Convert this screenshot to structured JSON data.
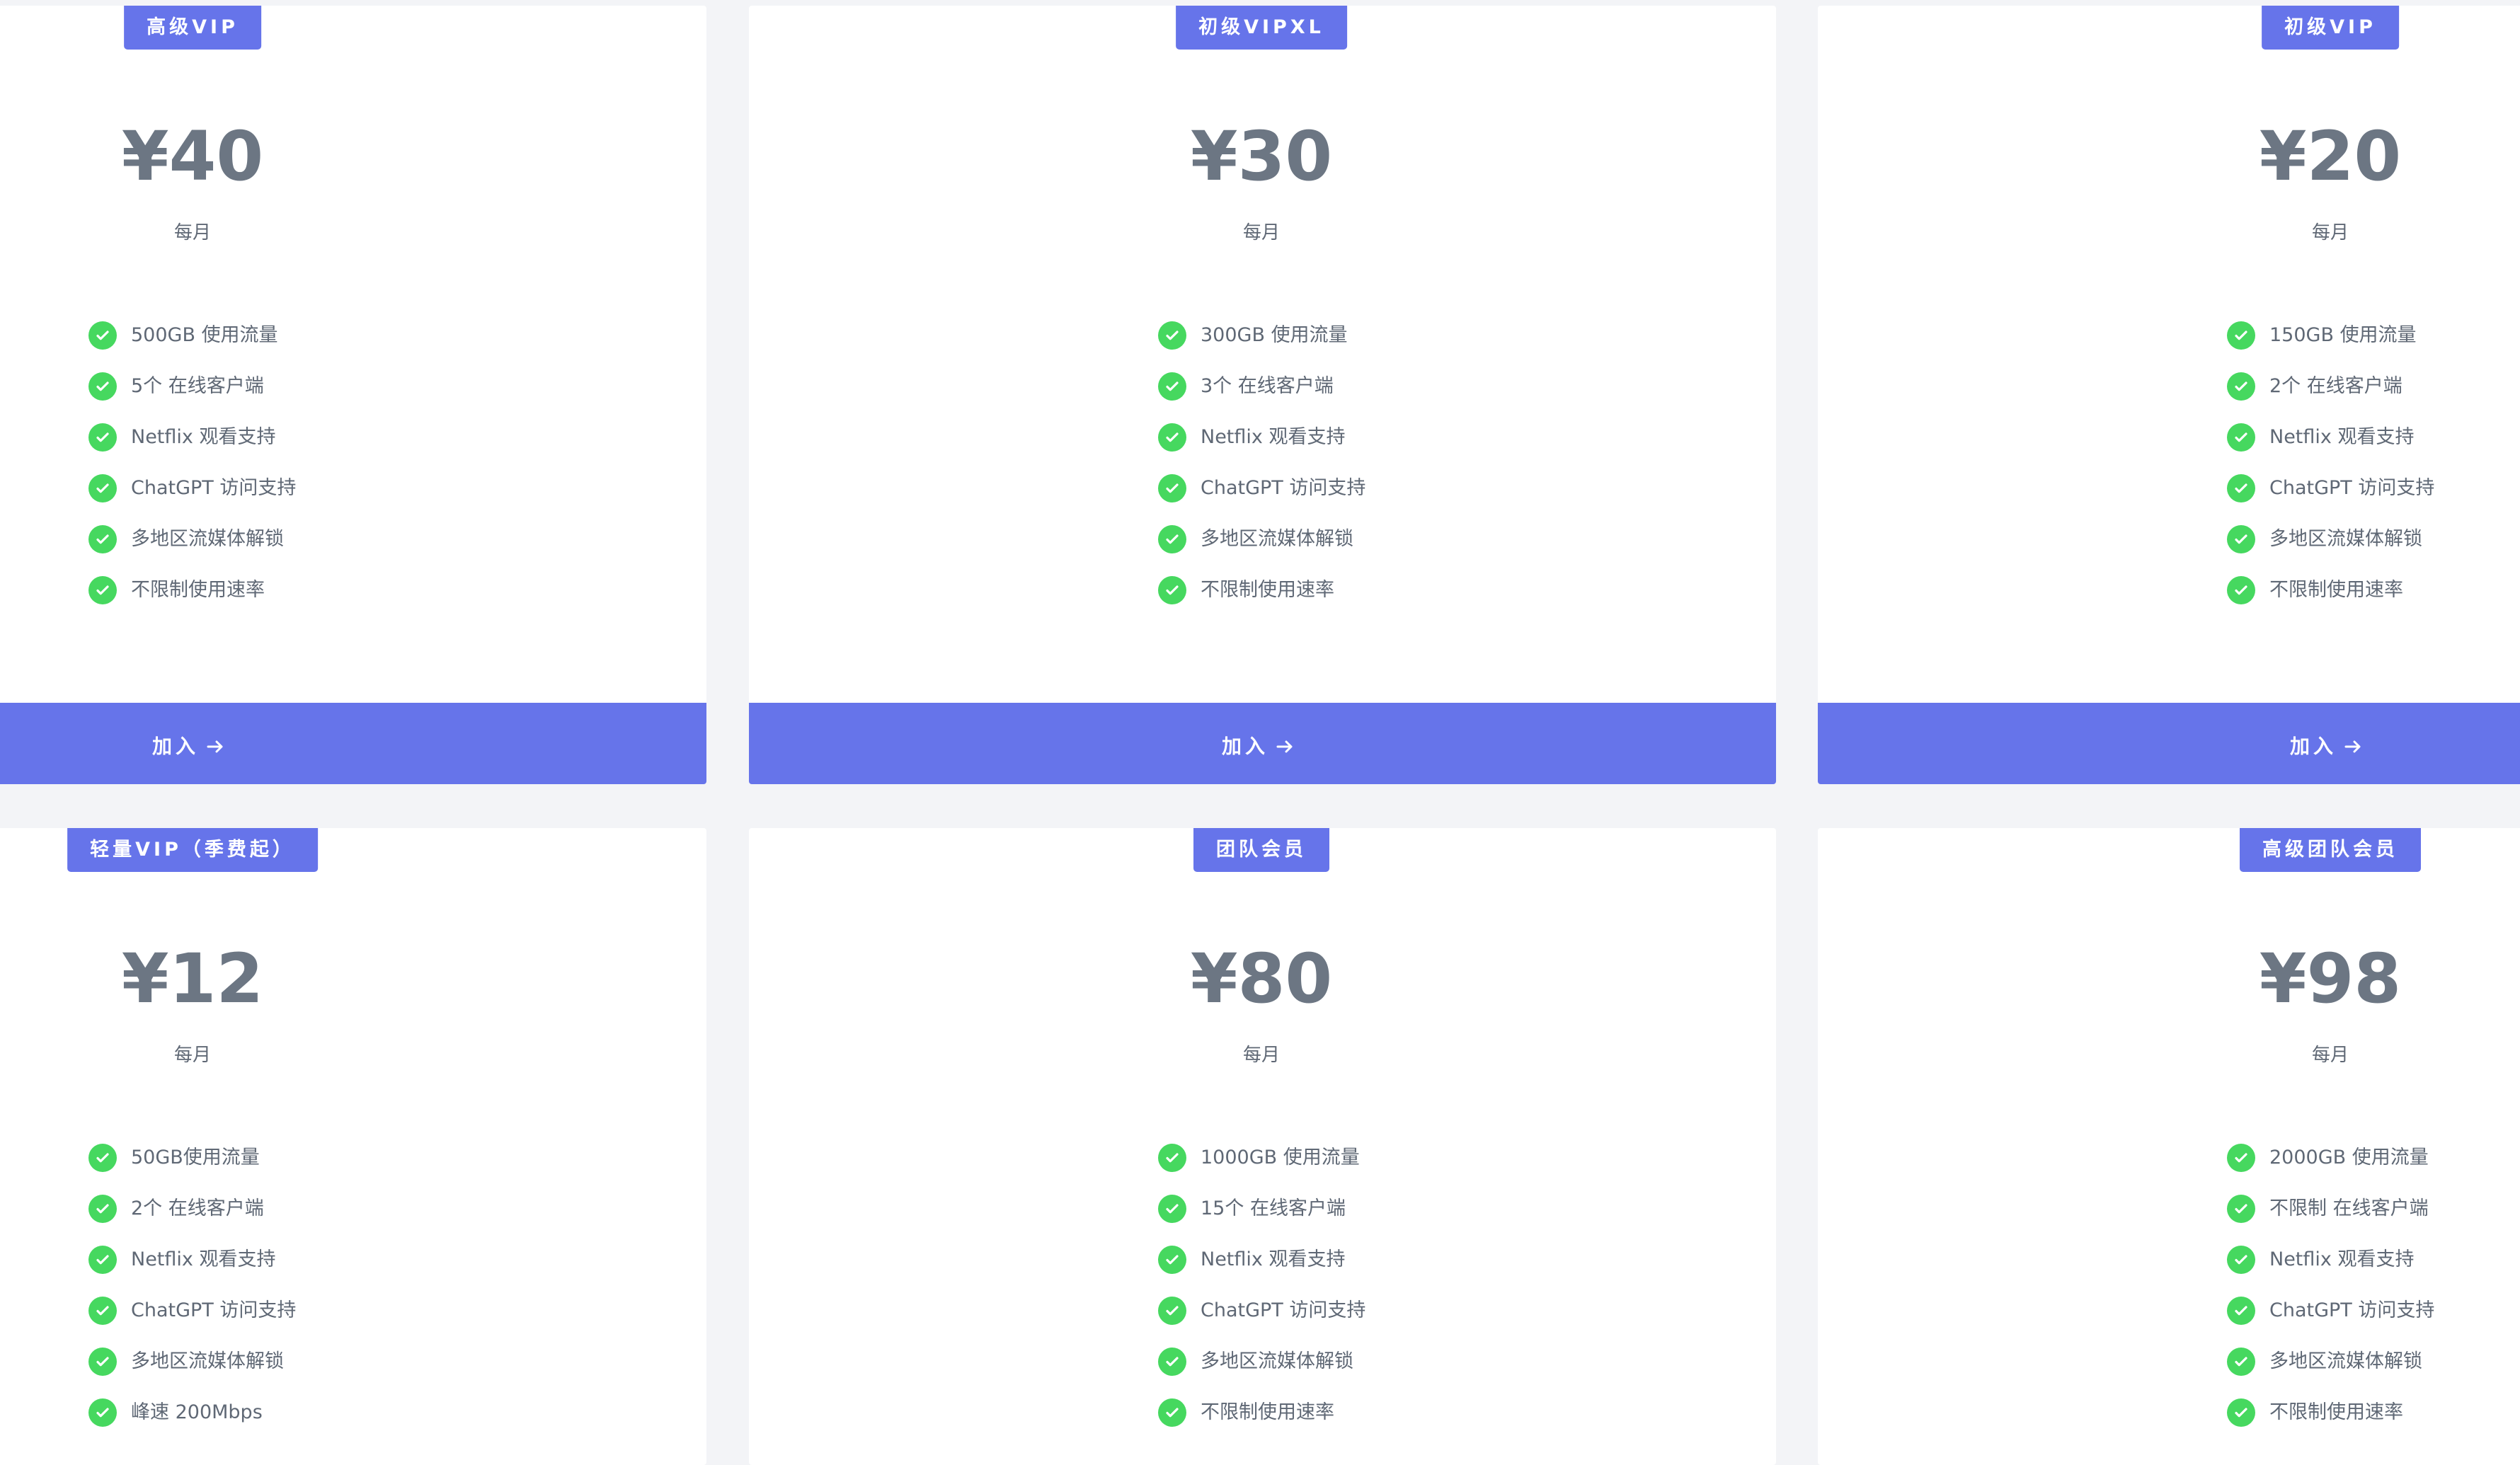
{
  "plans": [
    {
      "badge": "高级VIP",
      "price": "¥40",
      "period": "每月",
      "features": [
        "500GB 使用流量",
        "5个 在线客户端",
        "Netflix 观看支持",
        "ChatGPT 访问支持",
        "多地区流媒体解锁",
        "不限制使用速率"
      ],
      "button": "加入"
    },
    {
      "badge": "初级VIPXL",
      "price": "¥30",
      "period": "每月",
      "features": [
        "300GB 使用流量",
        "3个 在线客户端",
        "Netflix 观看支持",
        "ChatGPT 访问支持",
        "多地区流媒体解锁",
        "不限制使用速率"
      ],
      "button": "加入"
    },
    {
      "badge": "初级VIP",
      "price": "¥20",
      "period": "每月",
      "features": [
        "150GB 使用流量",
        "2个 在线客户端",
        "Netflix 观看支持",
        "ChatGPT 访问支持",
        "多地区流媒体解锁",
        "不限制使用速率"
      ],
      "button": "加入"
    },
    {
      "badge": "轻量VIP（季费起）",
      "price": "¥12",
      "period": "每月",
      "features": [
        "50GB使用流量",
        "2个 在线客户端",
        "Netflix 观看支持",
        "ChatGPT 访问支持",
        "多地区流媒体解锁",
        "峰速 200Mbps"
      ]
    },
    {
      "badge": "团队会员",
      "price": "¥80",
      "period": "每月",
      "features": [
        "1000GB 使用流量",
        "15个 在线客户端",
        "Netflix 观看支持",
        "ChatGPT 访问支持",
        "多地区流媒体解锁",
        "不限制使用速率"
      ]
    },
    {
      "badge": "高级团队会员",
      "price": "¥98",
      "period": "每月",
      "features": [
        "2000GB 使用流量",
        "不限制 在线客户端",
        "Netflix 观看支持",
        "ChatGPT 访问支持",
        "多地区流媒体解锁",
        "不限制使用速率"
      ]
    }
  ],
  "icons": {
    "feature": "check-circle-icon",
    "button": "arrow-right-icon"
  },
  "colors": {
    "accent": "#6674ea",
    "check": "#46d85f",
    "price": "#6c7683",
    "text": "#5f6875",
    "background": "#f3f4f7",
    "card": "#ffffff"
  }
}
